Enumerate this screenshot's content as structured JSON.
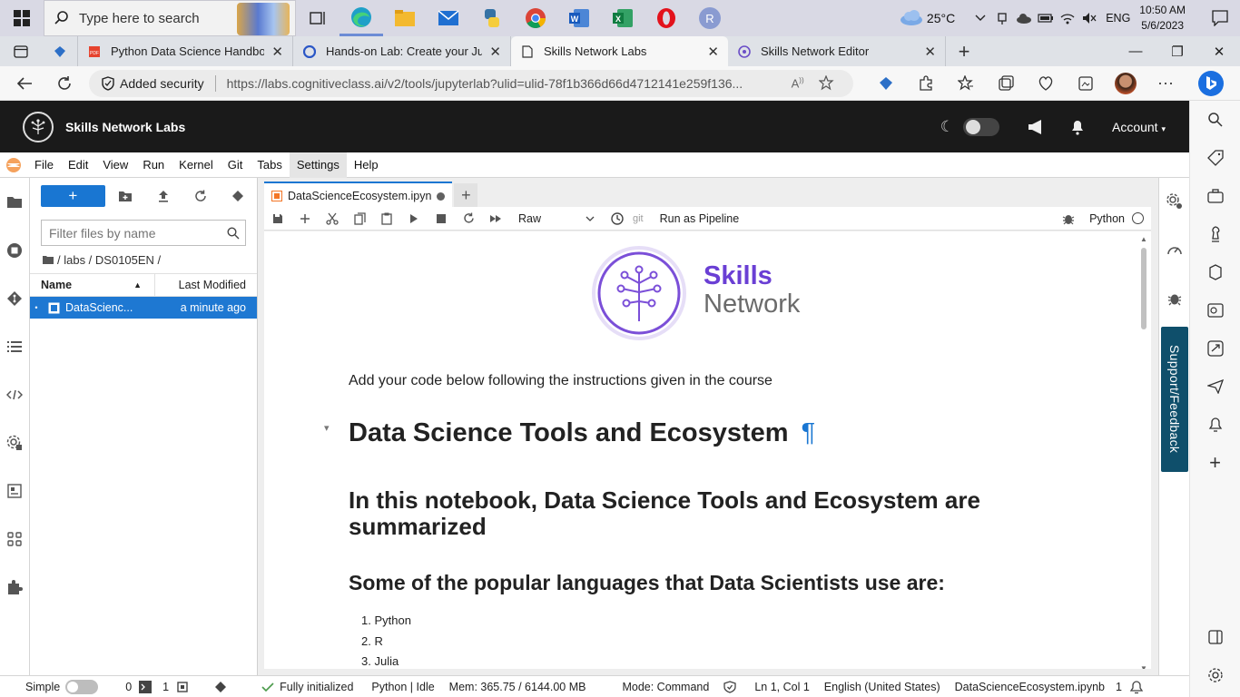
{
  "taskbar": {
    "search_placeholder": "Type here to search",
    "apps": [
      "task-view",
      "edge",
      "file-explorer",
      "mail",
      "python",
      "chrome",
      "word",
      "excel",
      "opera",
      "profile"
    ],
    "profile_letter": "R",
    "weather": "25°C",
    "lang": "ENG",
    "time": "10:50 AM",
    "date": "5/6/2023"
  },
  "browser": {
    "tabs": [
      {
        "title": "Python Data Science Handbook.p",
        "icon": "pdf-icon"
      },
      {
        "title": "Hands-on Lab: Create your Jupyt",
        "icon": "coursera-icon"
      },
      {
        "title": "Skills Network Labs",
        "icon": "page-icon"
      },
      {
        "title": "Skills Network Editor",
        "icon": "sn-icon"
      }
    ],
    "security_label": "Added security",
    "url": "https://labs.cognitiveclass.ai/v2/tools/jupyterlab?ulid=ulid-78f1b366d66d4712141e259f136..."
  },
  "header": {
    "brand": "Skills Network Labs",
    "account": "Account"
  },
  "menubar": [
    "File",
    "Edit",
    "View",
    "Run",
    "Kernel",
    "Git",
    "Tabs",
    "Settings",
    "Help"
  ],
  "filebrowser": {
    "new_label": "+",
    "filter_placeholder": "Filter files by name",
    "breadcrumb": "/ labs / DS0105EN /",
    "col_name": "Name",
    "col_modified": "Last Modified",
    "files": [
      {
        "name": "DataScienc...",
        "modified": "a minute ago"
      }
    ]
  },
  "notebook": {
    "tab_title": "DataScienceEcosystem.ipyn",
    "cell_type": "Raw",
    "git_label": "git",
    "pipeline_label": "Run as Pipeline",
    "kernel_name": "Python",
    "logo_line1": "Skills",
    "logo_line2": "Network",
    "intro": "Add your code below following the instructions given in the course",
    "h1": "Data Science Tools and Ecosystem",
    "pilcrow": "¶",
    "h2": "In this notebook, Data Science Tools and Ecosystem are summarized",
    "h3": "Some of the popular languages that Data Scientists use are:",
    "languages": [
      "Python",
      "R",
      "Julia"
    ]
  },
  "feedback_label": "Support/Feedback",
  "status": {
    "simple": "Simple",
    "count_a": "0",
    "count_b": "1",
    "init": "Fully initialized",
    "kernel": "Python | Idle",
    "mem": "Mem: 365.75 / 6144.00 MB",
    "mode": "Mode: Command",
    "pos": "Ln 1, Col 1",
    "lang": "English (United States)",
    "file": "DataScienceEcosystem.ipynb",
    "count_c": "1"
  },
  "colors": {
    "accent": "#1976d2",
    "header_bg": "#1a1a1a",
    "skills_purple": "#6a3fd4",
    "feedback_bg": "#0f4f6b"
  }
}
